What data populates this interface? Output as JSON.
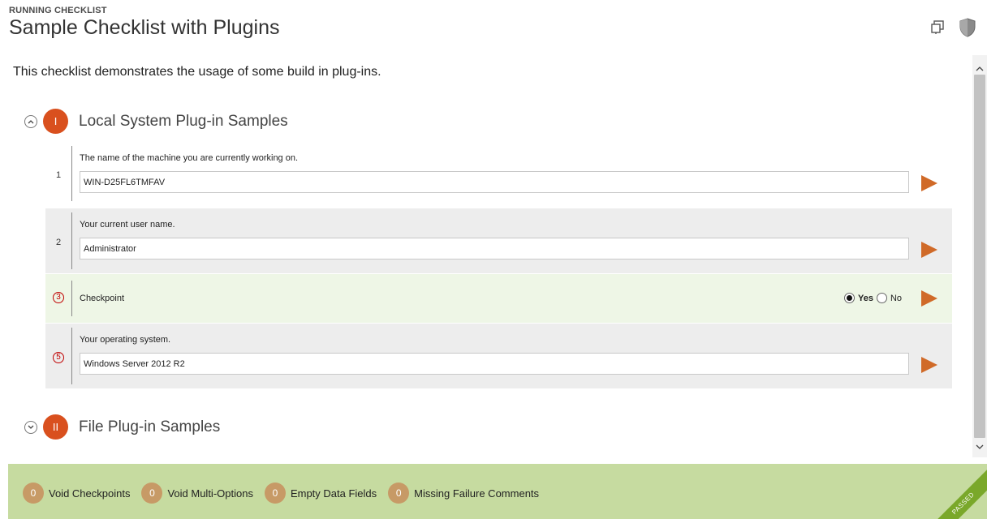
{
  "header": {
    "running_label": "RUNNING CHECKLIST",
    "title": "Sample Checklist with Plugins"
  },
  "top_icons": [
    "copy-window-icon",
    "shield-icon"
  ],
  "description": "This checklist demonstrates the usage of some build in plug-ins.",
  "sections": [
    {
      "badge": "I",
      "title": "Local System Plug-in Samples",
      "expanded": true
    },
    {
      "badge": "II",
      "title": "File Plug-in Samples",
      "expanded": false
    }
  ],
  "steps": [
    {
      "number": "1",
      "label": "The name of the machine you are currently working on.",
      "value": "WIN-D25FL6TMFAV"
    },
    {
      "number": "2",
      "label": "Your current user name.",
      "value": "Administrator"
    },
    {
      "number": "3",
      "label": "Checkpoint",
      "options": [
        "Yes",
        "No"
      ],
      "selected": "Yes"
    },
    {
      "number": "5",
      "label": "Your operating system.",
      "value": "Windows Server 2012 R2"
    }
  ],
  "footer": {
    "items": [
      {
        "count": "0",
        "label": "Void Checkpoints"
      },
      {
        "count": "0",
        "label": "Void Multi-Options"
      },
      {
        "count": "0",
        "label": "Empty Data Fields"
      },
      {
        "count": "0",
        "label": "Missing Failure Comments"
      }
    ],
    "status": "PASSED"
  },
  "colors": {
    "accent": "#d9501e",
    "play": "#d06a28",
    "footer_bg": "#c6dba0",
    "badge": "#c79a66",
    "passed": "#7aa82a"
  }
}
